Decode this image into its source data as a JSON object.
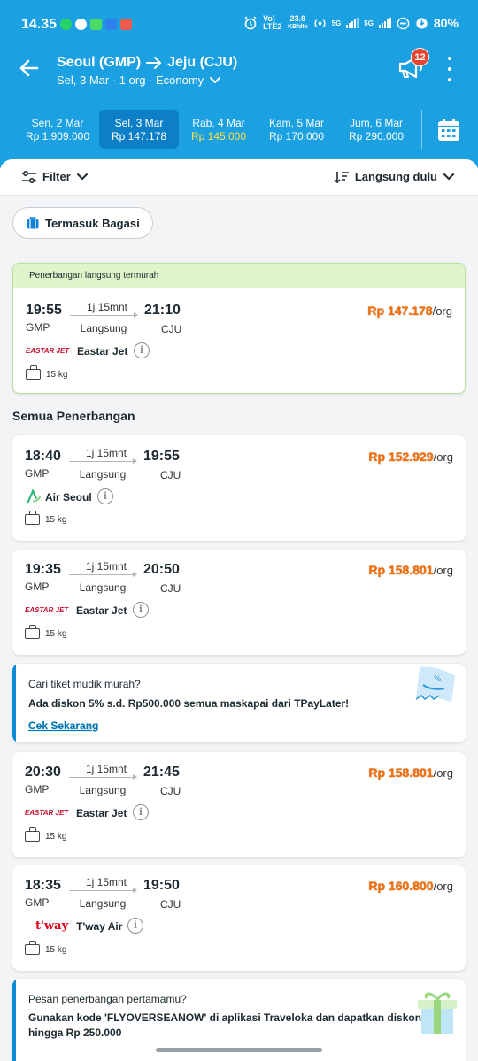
{
  "status_bar": {
    "time": "14.35",
    "network": "Vo) LTE2",
    "speed_value": "23.9",
    "speed_unit": "KB/dtk",
    "net1": "5G",
    "net2": "5G",
    "battery": "80%"
  },
  "header": {
    "origin": "Seoul (GMP)",
    "destination": "Jeju (CJU)",
    "subtitle": "Sel, 3 Mar · 1 org · Economy",
    "promo_badge": "12",
    "bg_color": "#1ba0e2"
  },
  "dates": [
    {
      "day": "Sen, 2 Mar",
      "price": "Rp 1.909.000",
      "active": false,
      "cheapest": false
    },
    {
      "day": "Sel, 3 Mar",
      "price": "Rp 147.178",
      "active": true,
      "cheapest": false
    },
    {
      "day": "Rab, 4 Mar",
      "price": "Rp 145.000",
      "active": false,
      "cheapest": true
    },
    {
      "day": "Kam, 5 Mar",
      "price": "Rp 170.000",
      "active": false,
      "cheapest": false
    },
    {
      "day": "Jum, 6 Mar",
      "price": "Rp 290.000",
      "active": false,
      "cheapest": false
    }
  ],
  "toolbar": {
    "filter_label": "Filter",
    "sort_label": "Langsung dulu"
  },
  "chip_label": "Termasuk Bagasi",
  "highlight_label": "Penerbangan langsung termurah",
  "section_title": "Semua Penerbangan",
  "flights": [
    {
      "dep_time": "19:55",
      "dep_code": "GMP",
      "arr_time": "21:10",
      "arr_code": "CJU",
      "duration": "1j 15mnt",
      "transit": "Langsung",
      "price": "Rp 147.178",
      "per": "/org",
      "airline": "Eastar Jet",
      "logo": "EASTAR JET",
      "baggage": "15 kg"
    },
    {
      "dep_time": "18:40",
      "dep_code": "GMP",
      "arr_time": "19:55",
      "arr_code": "CJU",
      "duration": "1j 15mnt",
      "transit": "Langsung",
      "price": "Rp 152.929",
      "per": "/org",
      "airline": "Air Seoul",
      "logo": "",
      "baggage": "15 kg"
    },
    {
      "dep_time": "19:35",
      "dep_code": "GMP",
      "arr_time": "20:50",
      "arr_code": "CJU",
      "duration": "1j 15mnt",
      "transit": "Langsung",
      "price": "Rp 158.801",
      "per": "/org",
      "airline": "Eastar Jet",
      "logo": "EASTAR JET",
      "baggage": "15 kg"
    },
    {
      "dep_time": "20:30",
      "dep_code": "GMP",
      "arr_time": "21:45",
      "arr_code": "CJU",
      "duration": "1j 15mnt",
      "transit": "Langsung",
      "price": "Rp 158.801",
      "per": "/org",
      "airline": "Eastar Jet",
      "logo": "EASTAR JET",
      "baggage": "15 kg"
    },
    {
      "dep_time": "18:35",
      "dep_code": "GMP",
      "arr_time": "19:50",
      "arr_code": "CJU",
      "duration": "1j 15mnt",
      "transit": "Langsung",
      "price": "Rp 160.800",
      "per": "/org",
      "airline": "T'way Air",
      "logo": "t'way",
      "baggage": "15 kg"
    }
  ],
  "promos": [
    {
      "title": "Cari tiket mudik murah?",
      "desc": "Ada diskon 5% s.d. Rp500.000 semua maskapai dari TPayLater!",
      "link": "Cek Sekarang"
    },
    {
      "title": "Pesan penerbangan pertamamu?",
      "desc": "Gunakan kode 'FLYOVERSEANOW' di aplikasi Traveloka dan dapatkan diskon hingga Rp 250.000",
      "link": ""
    }
  ]
}
